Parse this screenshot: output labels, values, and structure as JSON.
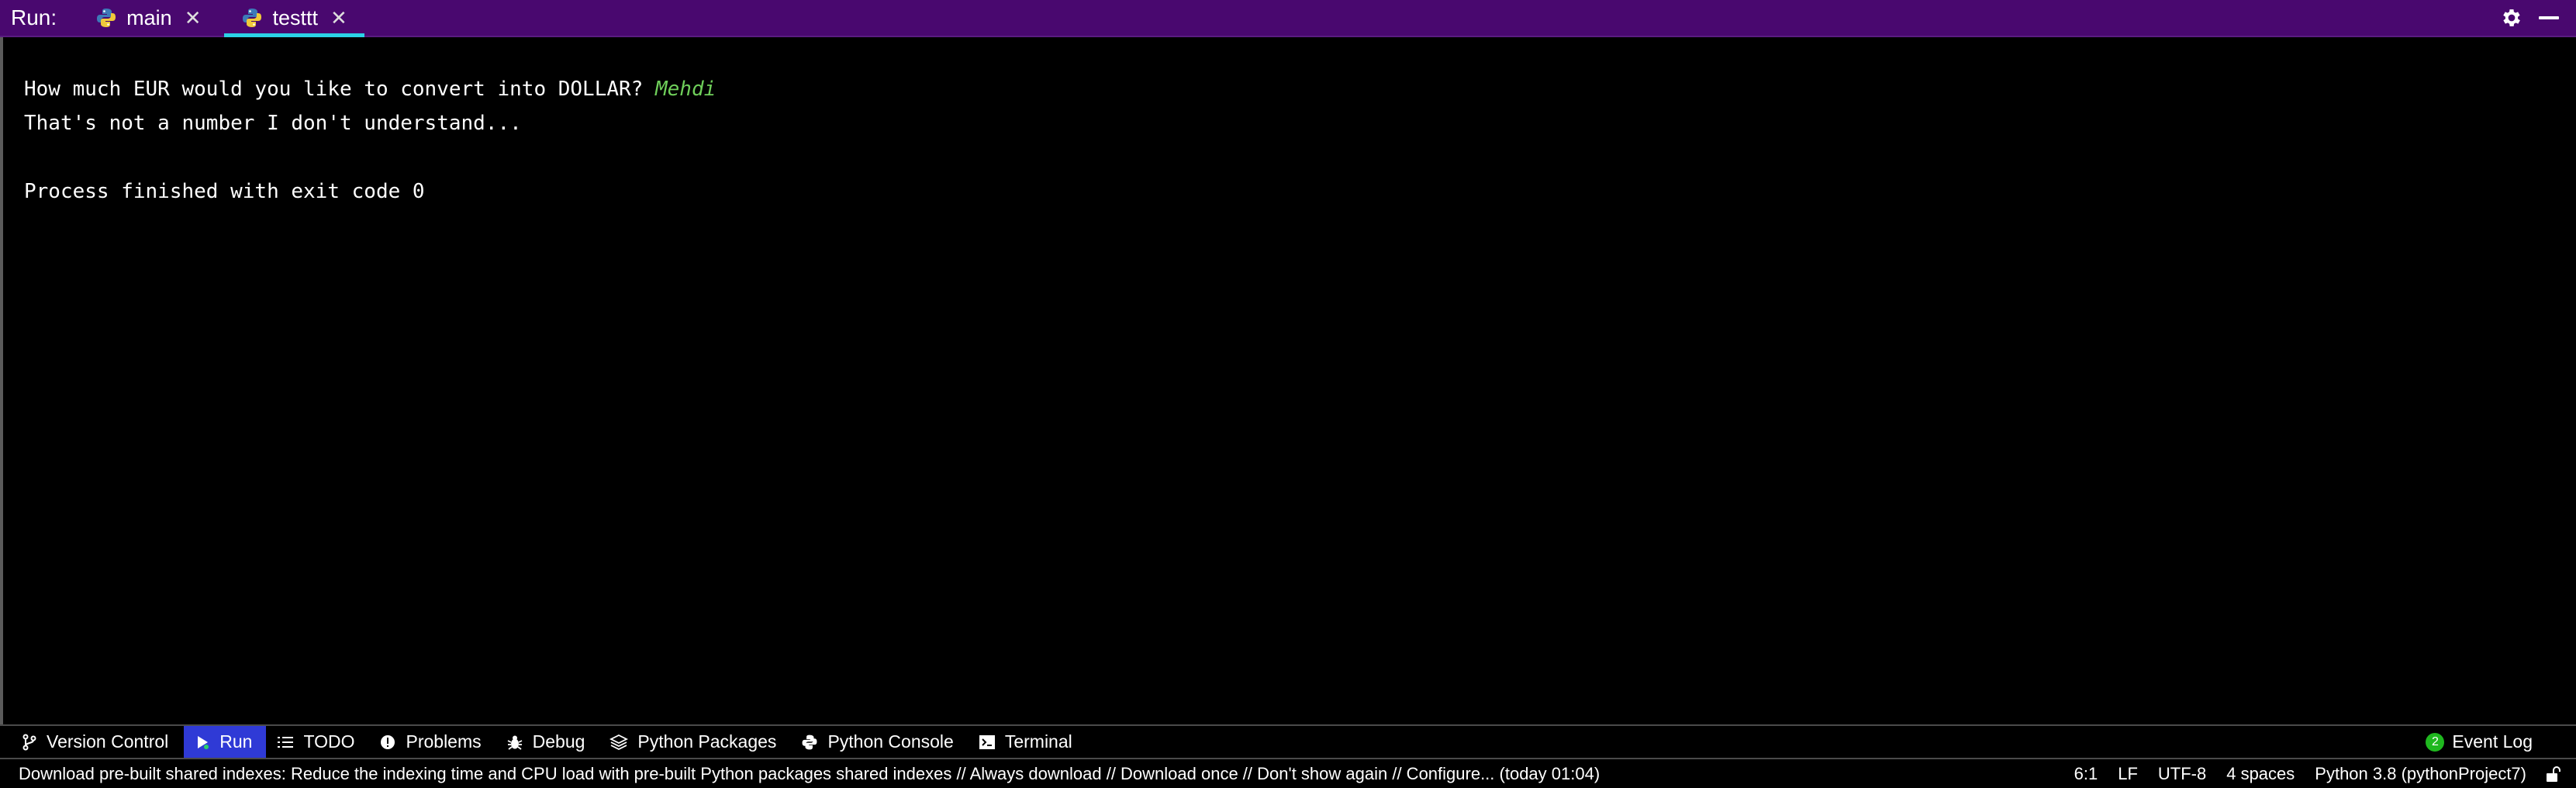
{
  "run_bar": {
    "label": "Run:",
    "tabs": [
      {
        "label": "main",
        "icon": "python-icon",
        "active": false
      },
      {
        "label": "testtt",
        "icon": "python-icon",
        "active": true
      }
    ],
    "close_glyph": "✕",
    "accent_color": "#2bd3e6",
    "background_color": "#49086f"
  },
  "console": {
    "prompt_text": "How much EUR would you like to convert into DOLLAR? ",
    "user_input": "Mehdi",
    "error_text": "That's not a number I don't understand...",
    "exit_text": "Process finished with exit code 0",
    "input_color": "#6fcf5a"
  },
  "tool_bar": {
    "tabs": [
      {
        "label": "Version Control",
        "icon": "branch-icon"
      },
      {
        "label": "Run",
        "icon": "play-icon",
        "active": true
      },
      {
        "label": "TODO",
        "icon": "list-icon"
      },
      {
        "label": "Problems",
        "icon": "warning-icon"
      },
      {
        "label": "Debug",
        "icon": "bug-icon"
      },
      {
        "label": "Python Packages",
        "icon": "layers-icon"
      },
      {
        "label": "Python Console",
        "icon": "python-icon"
      },
      {
        "label": "Terminal",
        "icon": "terminal-icon"
      }
    ],
    "event_log": {
      "label": "Event Log",
      "count": "2"
    }
  },
  "status_bar": {
    "message": "Download pre-built shared indexes: Reduce the indexing time and CPU load with pre-built Python packages shared indexes // Always download // Download once // Don't show again // Configure... (today 01:04)",
    "caret_position": "6:1",
    "line_separator": "LF",
    "encoding": "UTF-8",
    "indent": "4 spaces",
    "interpreter": "Python 3.8 (pythonProject7)"
  }
}
